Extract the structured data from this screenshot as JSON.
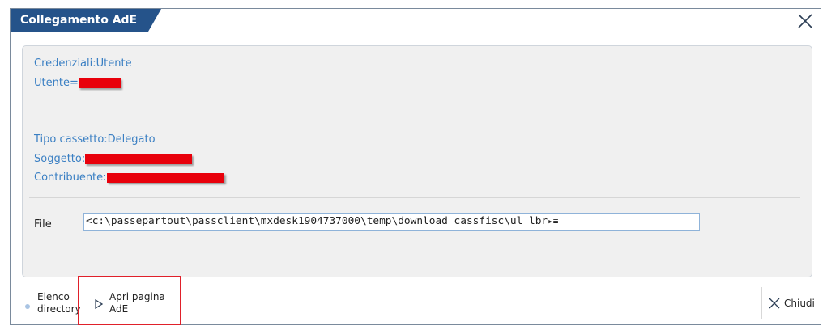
{
  "window": {
    "title": "Collegamento AdE"
  },
  "credentials": {
    "label": "Credenziali:Utente",
    "user_label": "Utente="
  },
  "cassetto": {
    "tipo_label": "Tipo cassetto:Delegato",
    "soggetto_label": "Soggetto:",
    "contribuente_label": "Contribuente:"
  },
  "file": {
    "label": "File",
    "value": "<c:\\passepartout\\passclient\\mxdesk1904737000\\temp\\download_cassfisc\\ul_lbr"
  },
  "footer": {
    "elenco_line1": "Elenco",
    "elenco_line2": "directory",
    "apri_line1": "Apri pagina",
    "apri_line2": "AdE",
    "chiudi_label": "Chiudi"
  },
  "colors": {
    "title_bg": "#25538a",
    "info_text": "#3a7fc3",
    "redaction": "#e8000b",
    "highlight_box": "#e0202a"
  }
}
